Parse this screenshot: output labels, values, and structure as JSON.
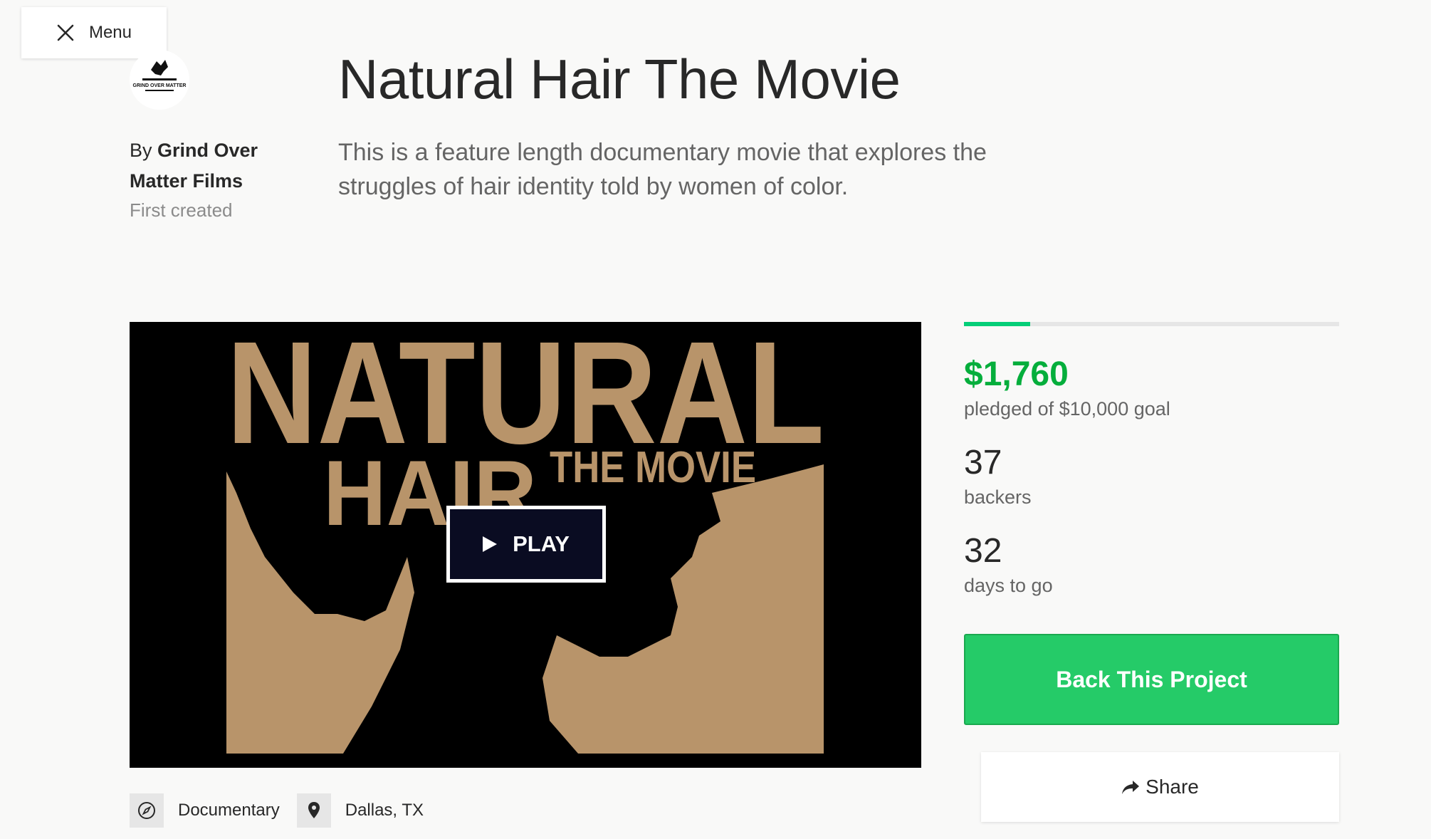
{
  "menu": {
    "label": "Menu",
    "icon": "close-icon"
  },
  "creator": {
    "by_label": "By",
    "name": "Grind Over Matter Films",
    "first_created": "First created",
    "logo_text": "GRIND OVER MATTER"
  },
  "project": {
    "title": "Natural Hair The Movie",
    "blurb": "This is a feature length documentary movie that explores the struggles of hair identity told by women of color."
  },
  "video": {
    "poster_word1": "NATURAL",
    "poster_word2": "HAIR",
    "poster_word3": "THE MOVIE",
    "play_label": "PLAY",
    "poster_color": "#b8946a"
  },
  "tags": [
    {
      "label": "Documentary",
      "icon": "compass-icon"
    },
    {
      "label": "Dallas, TX",
      "icon": "location-pin-icon"
    }
  ],
  "funding": {
    "progress": 0.176,
    "pledged": "$1,760",
    "pledged_sub": "pledged of $10,000 goal",
    "backers": "37",
    "backers_label": "backers",
    "days": "32",
    "days_label": "days to go"
  },
  "actions": {
    "back_label": "Back This Project",
    "share_label": "Share"
  },
  "colors": {
    "accent_green": "#05ae3c",
    "button_green": "#25cb68",
    "progress_green": "#05ce78"
  }
}
